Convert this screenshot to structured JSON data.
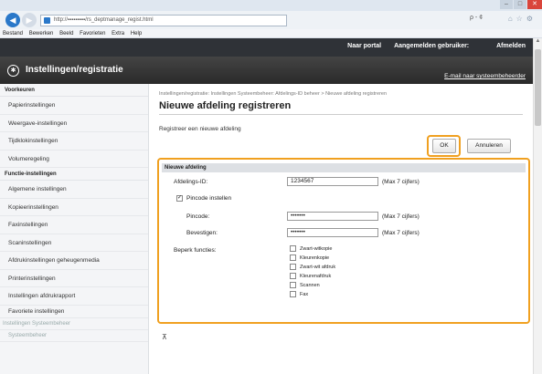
{
  "browser": {
    "url": "http://▪▪▪▪▪▪▪▪▪/rs_deptmanage_regist.html",
    "url_controls": "ρ - ¢",
    "menu": [
      "Bestand",
      "Bewerken",
      "Beeld",
      "Favorieten",
      "Extra",
      "Help"
    ]
  },
  "header": {
    "device_name": "",
    "portal_link": "Naar portal",
    "user_label": "Aangemelden gebruiker:",
    "logout_link": "Afmelden",
    "title": "Instellingen/registratie",
    "mail_link": "E-mail naar systeembeheerder"
  },
  "sidebar": {
    "section1": "Voorkeuren",
    "items1": [
      "Papierinstellingen",
      "Weergave-instellingen",
      "Tijdklokinstellingen",
      "Volumeregeling"
    ],
    "section2": "Functie-instellingen",
    "items2": [
      "Algemene instellingen",
      "Kopieerinstellingen",
      "Faxinstellingen",
      "Scaninstellingen",
      "Afdrukinstellingen geheugenmedia",
      "Printerinstellingen",
      "Instellingen afdrukrapport",
      "Favoriete instellingen"
    ],
    "section3": "Instellingen Systeembeheer",
    "items3": [
      "Systeembeheer"
    ]
  },
  "main": {
    "breadcrumb": "Instellingen/registratie: Instellingen Systeembeheer: Afdelings-ID beheer > Nieuwe afdeling registreren",
    "title": "Nieuwe afdeling registreren",
    "subtitle": "Registreer een nieuwe afdeling",
    "ok_label": "OK",
    "cancel_label": "Annuleren",
    "section_title": "Nieuwe afdeling",
    "dept_id_label": "Afdelings-ID:",
    "dept_id_value": "1234567",
    "dept_id_hint": "(Max 7 cijfers)",
    "pin_checkbox_label": "Pincode instellen",
    "pin_label": "Pincode:",
    "pin_value": "•••••••",
    "pin_hint": "(Max 7 cijfers)",
    "confirm_label": "Bevestigen:",
    "confirm_value": "•••••••",
    "confirm_hint": "(Max 7 cijfers)",
    "restrict_label": "Beperk functies:",
    "functions": [
      "Zwart-witkopie",
      "Kleurenkopie",
      "Zwart-wit afdruk",
      "Kleurenafdruk",
      "Scannen",
      "Fax"
    ],
    "top_link": "⊼"
  }
}
